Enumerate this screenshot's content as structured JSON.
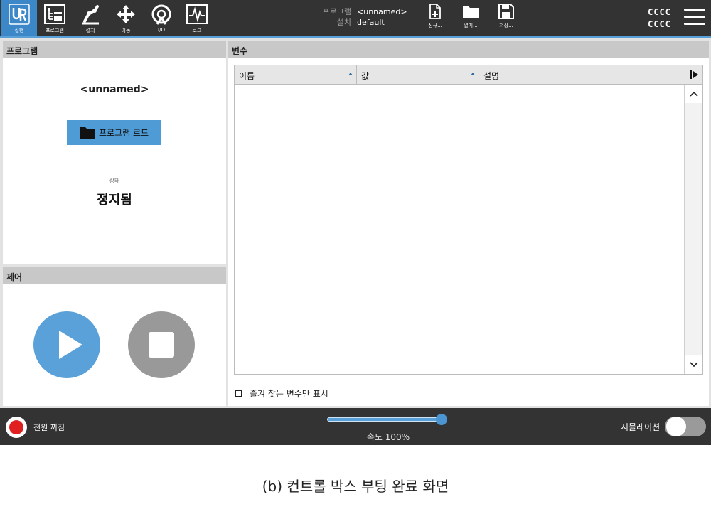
{
  "nav": {
    "items": [
      {
        "label": "실행",
        "icon": "ur-logo-icon",
        "active": true
      },
      {
        "label": "프로그램",
        "icon": "program-icon"
      },
      {
        "label": "설치",
        "icon": "installation-icon"
      },
      {
        "label": "이동",
        "icon": "move-icon"
      },
      {
        "label": "I/O",
        "icon": "io-icon"
      },
      {
        "label": "로그",
        "icon": "log-icon"
      }
    ]
  },
  "program_info": {
    "program_key": "프로그램",
    "program_value": "<unnamed>",
    "install_key": "설치",
    "install_value": "default"
  },
  "file_buttons": {
    "new": "신규...",
    "open": "열기...",
    "save": "저장..."
  },
  "top_right": {
    "line1": "CCCC",
    "line2": "CCCC"
  },
  "program_panel": {
    "title": "프로그램",
    "program_name": "<unnamed>",
    "load_button": "프로그램 로드",
    "status_label": "상태",
    "status_value": "정지됨"
  },
  "control_panel": {
    "title": "제어"
  },
  "vars_panel": {
    "title": "변수",
    "columns": [
      "이름",
      "값",
      "설명"
    ],
    "rows": [],
    "favorites_label": "즐겨 찾는 변수만 표시",
    "favorites_checked": false
  },
  "bottom": {
    "power_label": "전원 꺼짐",
    "speed_label": "속도 100%",
    "speed_fraction": 1.0,
    "simulation_label": "시뮬레이션",
    "simulation_on": false
  },
  "caption": "(b) 컨트롤 박스 부팅 완료 화면",
  "colors": {
    "topbar": "#333333",
    "accent": "#5aa0d8",
    "active_nav": "#3c87c8",
    "stop_button": "#999999",
    "power_on_indicator": "#e02020"
  }
}
